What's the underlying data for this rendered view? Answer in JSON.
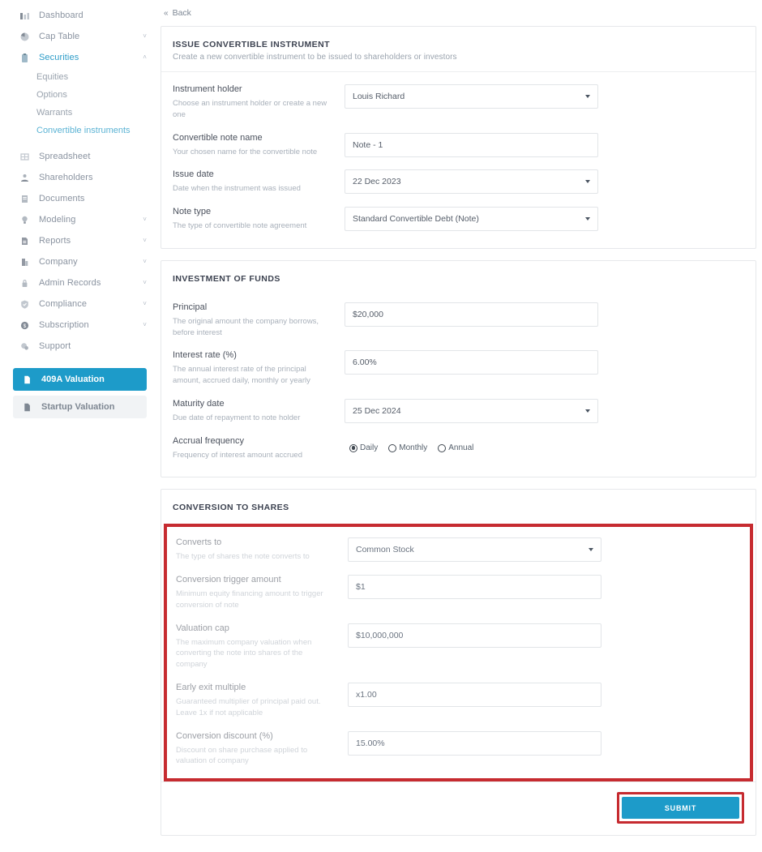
{
  "sidebar": {
    "items": [
      {
        "label": "Dashboard",
        "icon": "bar-chart-icon",
        "caret": "",
        "state": "normal"
      },
      {
        "label": "Cap Table",
        "icon": "pie-chart-icon",
        "caret": "˅",
        "state": "normal"
      },
      {
        "label": "Securities",
        "icon": "clipboard-icon",
        "caret": "˄",
        "state": "active"
      }
    ],
    "securities_children": [
      {
        "label": "Equities",
        "selected": false
      },
      {
        "label": "Options",
        "selected": false
      },
      {
        "label": "Warrants",
        "selected": false
      },
      {
        "label": "Convertible instruments",
        "selected": true
      }
    ],
    "items2": [
      {
        "label": "Spreadsheet",
        "icon": "grid-icon",
        "caret": ""
      },
      {
        "label": "Shareholders",
        "icon": "person-icon",
        "caret": ""
      },
      {
        "label": "Documents",
        "icon": "document-icon",
        "caret": ""
      },
      {
        "label": "Modeling",
        "icon": "lightbulb-icon",
        "caret": "˅"
      },
      {
        "label": "Reports",
        "icon": "report-icon",
        "caret": "˅"
      },
      {
        "label": "Company",
        "icon": "building-icon",
        "caret": "˅"
      },
      {
        "label": "Admin Records",
        "icon": "lock-icon",
        "caret": "˅"
      },
      {
        "label": "Compliance",
        "icon": "shield-check-icon",
        "caret": "˅"
      },
      {
        "label": "Subscription",
        "icon": "dollar-circle-icon",
        "caret": "˅"
      },
      {
        "label": "Support",
        "icon": "support-icon",
        "caret": ""
      }
    ],
    "cta": [
      {
        "label": "409A Valuation",
        "icon": "file-icon",
        "style": "primary"
      },
      {
        "label": "Startup Valuation",
        "icon": "briefcase-icon",
        "style": "muted"
      }
    ],
    "active_color": "#1d9bc9",
    "link_color": "#2d9cc8"
  },
  "header": {
    "back_label": "Back",
    "back_icon": "double-chevron-left-icon"
  },
  "issue_card": {
    "title": "ISSUE CONVERTIBLE INSTRUMENT",
    "subtitle": "Create a new convertible instrument to be issued to shareholders or investors",
    "fields": [
      {
        "label": "Instrument holder",
        "help": "Choose an instrument holder or create a new one",
        "value": "Louis Richard",
        "type": "select"
      },
      {
        "label": "Convertible note name",
        "help": "Your chosen name for the convertible note",
        "value": "Note - 1",
        "type": "text"
      },
      {
        "label": "Issue date",
        "help": "Date when the instrument was issued",
        "value": "22 Dec 2023",
        "type": "select"
      },
      {
        "label": "Note type",
        "help": "The type of convertible note agreement",
        "value": "Standard Convertible Debt (Note)",
        "type": "select"
      }
    ]
  },
  "investment_card": {
    "title": "INVESTMENT OF FUNDS",
    "fields": [
      {
        "label": "Principal",
        "help": "The original amount the company borrows, before interest",
        "value": "$20,000",
        "type": "text"
      },
      {
        "label": "Interest rate (%)",
        "help": "The annual interest rate of the principal amount, accrued daily, monthly or yearly",
        "value": "6.00%",
        "type": "text"
      },
      {
        "label": "Maturity date",
        "help": "Due date of repayment to note holder",
        "value": "25 Dec 2024",
        "type": "select"
      }
    ],
    "accrual": {
      "label": "Accrual frequency",
      "help": "Frequency of interest amount accrued",
      "options": [
        "Daily",
        "Monthly",
        "Annual"
      ],
      "selected": "Daily"
    }
  },
  "conversion_card": {
    "title": "CONVERSION TO SHARES",
    "highlight_color": "#c62b30",
    "fields": [
      {
        "label": "Converts to",
        "help": "The type of shares the note converts to",
        "value": "Common Stock",
        "type": "select"
      },
      {
        "label": "Conversion trigger amount",
        "help": "Minimum equity financing amount to trigger conversion of note",
        "value": "$1",
        "type": "text"
      },
      {
        "label": "Valuation cap",
        "help": "The maximum company valuation when converting the note into shares of the company",
        "value": "$10,000,000",
        "type": "text"
      },
      {
        "label": "Early exit multiple",
        "help": "Guaranteed multiplier of principal paid out. Leave 1x if not applicable",
        "value": "x1.00",
        "type": "text"
      },
      {
        "label": "Conversion discount (%)",
        "help": "Discount on share purchase applied to valuation of company",
        "value": "15.00%",
        "type": "text"
      }
    ]
  },
  "footer": {
    "submit_label": "SUBMIT",
    "submit_color": "#1d9bc9"
  }
}
